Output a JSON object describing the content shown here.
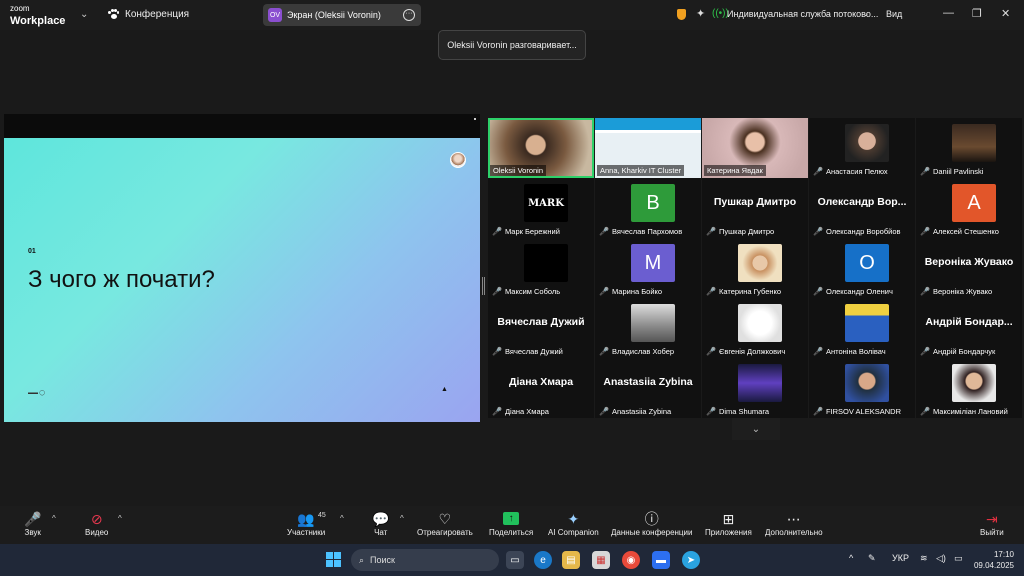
{
  "app": {
    "logo_small": "zoom",
    "logo_big": "Workplace",
    "meeting_label": "Конференция"
  },
  "share_pill": {
    "badge": "OV",
    "label": "Экран (Oleksii Voronin)"
  },
  "top_right": {
    "streaming_label": "Индивидуальная служба потоково...",
    "view_label": "Вид"
  },
  "toast": "Oleksii Voronin разговаривает...",
  "slide": {
    "number": "01",
    "title": "З чого ж почати?"
  },
  "gallery": [
    {
      "name": "Oleksii Voronin",
      "kind": "video",
      "muted": false,
      "active": true
    },
    {
      "name": "Anna, Kharkiv IT Cluster",
      "kind": "video",
      "muted": false
    },
    {
      "name": "Катерина Явдак",
      "kind": "video",
      "muted": false
    },
    {
      "name": "Анастасия Пелюх",
      "kind": "photo",
      "muted": true
    },
    {
      "name": "Daniil Pavlinski",
      "kind": "photo",
      "muted": true
    },
    {
      "name": "Марк Бережний",
      "kind": "logo",
      "logo": "MARK",
      "muted": true
    },
    {
      "name": "Вячеслав Пархомов",
      "kind": "letter",
      "letter": "B",
      "color": "#2e9b3a",
      "muted": true
    },
    {
      "name": "Пушкар Дмитро",
      "kind": "text",
      "big": "Пушкар Дмитро",
      "muted": true
    },
    {
      "name": "Олександр Воробйов",
      "kind": "text",
      "big": "Олександр Вор...",
      "muted": true
    },
    {
      "name": "Алексей Стешенко",
      "kind": "letter",
      "letter": "A",
      "color": "#e2562a",
      "muted": true
    },
    {
      "name": "Максим Соболь",
      "kind": "blank",
      "muted": true
    },
    {
      "name": "Марина Бойко",
      "kind": "letter",
      "letter": "M",
      "color": "#6b5ed0",
      "muted": true
    },
    {
      "name": "Катерина Губенко",
      "kind": "photo",
      "muted": true
    },
    {
      "name": "Олександр Оленич",
      "kind": "letter",
      "letter": "O",
      "color": "#1670c8",
      "muted": true
    },
    {
      "name": "Вероніка Жувако",
      "kind": "text",
      "big": "Вероніка Жувако",
      "muted": true
    },
    {
      "name": "Вячеслав Дужий",
      "kind": "text",
      "big": "Вячеслав Дужий",
      "muted": true
    },
    {
      "name": "Владислав Хобер",
      "kind": "photo",
      "muted": true
    },
    {
      "name": "Євгенія Должкович",
      "kind": "photo",
      "muted": true
    },
    {
      "name": "Антоніна Волівач",
      "kind": "photo",
      "muted": true
    },
    {
      "name": "Андрій Бондарчук",
      "kind": "text",
      "big": "Андрій Бондар...",
      "muted": true
    },
    {
      "name": "Діана Хмара",
      "kind": "text",
      "big": "Діана Хмара",
      "muted": true
    },
    {
      "name": "Anastasiia Zybina",
      "kind": "text",
      "big": "Anastasiia Zybina",
      "muted": true
    },
    {
      "name": "Dima Shumara",
      "kind": "photo",
      "muted": true
    },
    {
      "name": "FIRSOV ALEKSANDR",
      "kind": "photo",
      "muted": true
    },
    {
      "name": "Максиміліан Лановий",
      "kind": "photo",
      "muted": true
    }
  ],
  "toolbar": {
    "audio": "Звук",
    "video": "Видео",
    "participants": "Участники",
    "participants_count": "45",
    "chat": "Чат",
    "react": "Отреагировать",
    "share": "Поделиться",
    "ai": "AI Companion",
    "info": "Данные конференции",
    "apps": "Приложения",
    "more": "Дополнительно",
    "leave": "Выйти"
  },
  "taskbar": {
    "search": "Поиск",
    "lang": "УКР",
    "time": "17:10",
    "date": "09.04.2025"
  }
}
